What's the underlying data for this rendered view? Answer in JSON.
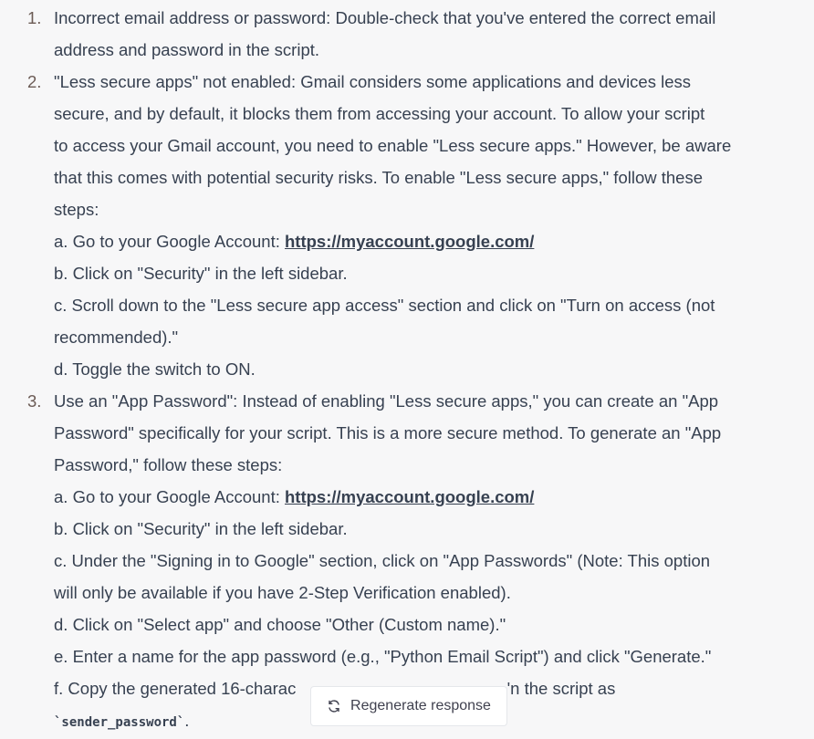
{
  "items": [
    {
      "number": "1.",
      "lines": [
        "Incorrect email address or password: Double-check that you've entered the correct email",
        "address and password in the script."
      ]
    },
    {
      "number": "2.",
      "lines": [
        "\"Less secure apps\" not enabled: Gmail considers some applications and devices less",
        "secure, and by default, it blocks them from accessing your account. To allow your script",
        "to access your Gmail account, you need to enable \"Less secure apps.\" However, be aware",
        "that this comes with potential security risks. To enable \"Less secure apps,\" follow these",
        "steps:"
      ],
      "step_a_prefix": "a. Go to your Google Account: ",
      "step_a_link": "https://myaccount.google.com/",
      "steps": [
        "b. Click on \"Security\" in the left sidebar.",
        "c. Scroll down to the \"Less secure app access\" section and click on \"Turn on access (not",
        "recommended).\"",
        "d. Toggle the switch to ON."
      ]
    },
    {
      "number": "3.",
      "lines": [
        "Use an \"App Password\": Instead of enabling \"Less secure apps,\" you can create an \"App",
        "Password\" specifically for your script. This is a more secure method. To generate an \"App",
        "Password,\" follow these steps:"
      ],
      "step_a_prefix": "a. Go to your Google Account: ",
      "step_a_link": "https://myaccount.google.com/",
      "steps": [
        "b. Click on \"Security\" in the left sidebar.",
        "c. Under the \"Signing in to Google\" section, click on \"App Passwords\" (Note: This option",
        "will only be available if you have 2-Step Verification enabled).",
        "d. Click on \"Select app\" and choose \"Other (Custom name).\"",
        "e. Enter a name for the app password (e.g., \"Python Email Script\") and click \"Generate.\"",
        "f. Copy the generated 16-charac                              ,           ,  'n the script as"
      ],
      "code": "`sender_password`",
      "code_suffix": "."
    }
  ],
  "regenerate": {
    "label": "Regenerate response",
    "icon": "refresh-icon"
  }
}
